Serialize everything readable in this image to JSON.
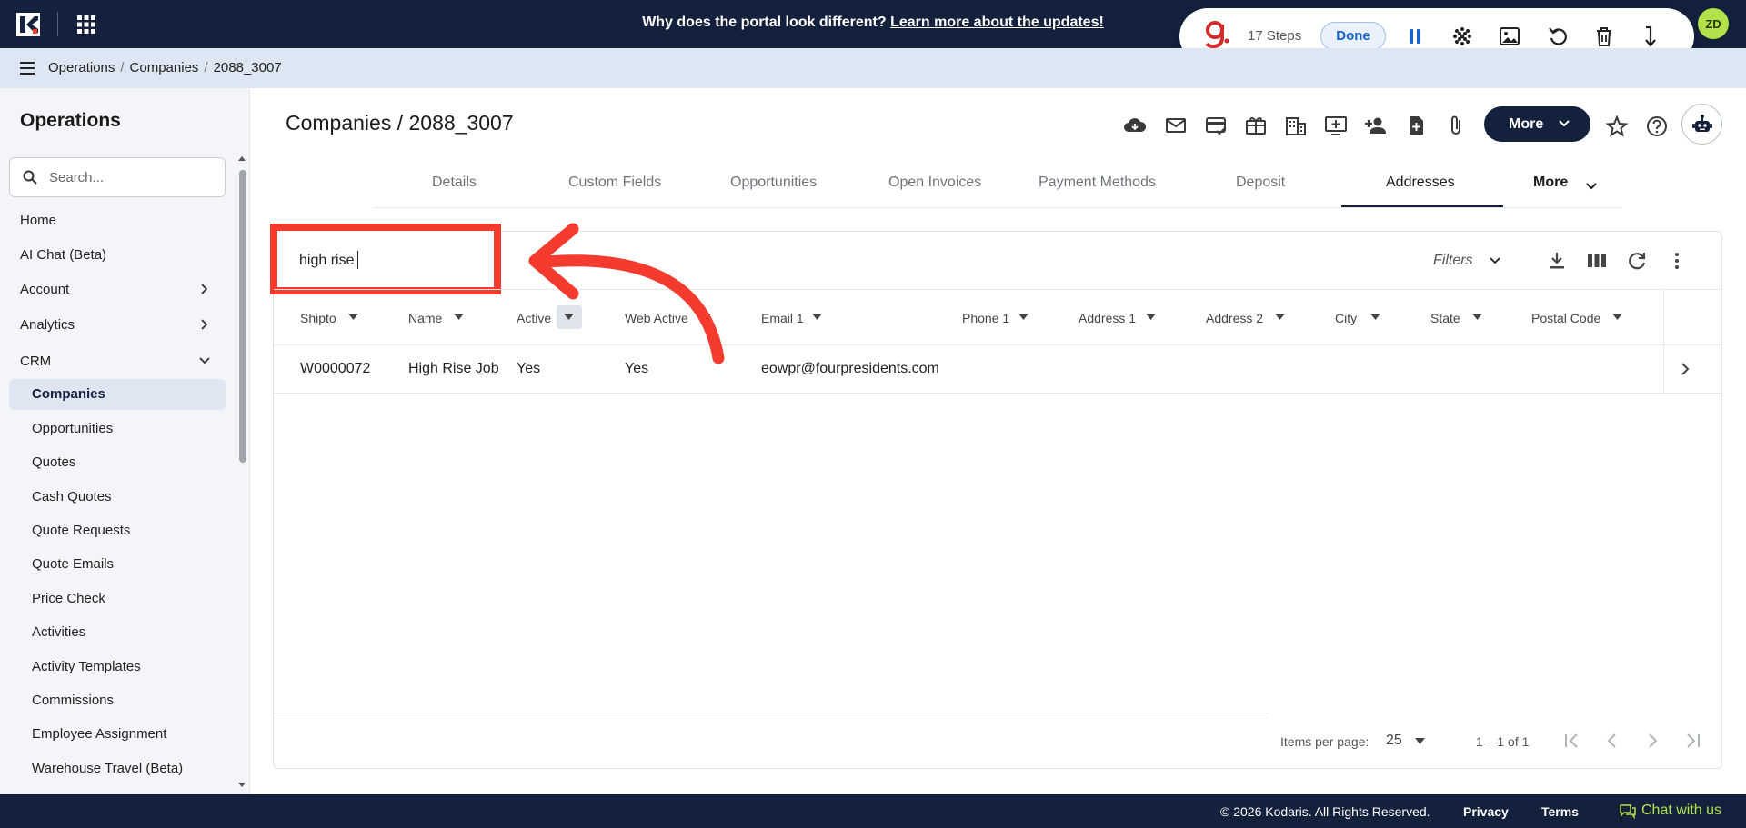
{
  "banner": {
    "text": "Why does the portal look different? ",
    "link": "Learn more about the updates!"
  },
  "recorder": {
    "steps": "17 Steps",
    "done": "Done"
  },
  "user": {
    "initials": "ZD"
  },
  "breadcrumb": {
    "items": [
      "Operations",
      "Companies",
      "2088_3007"
    ]
  },
  "sidebar": {
    "title": "Operations",
    "search_placeholder": "Search...",
    "items": [
      "Home",
      "AI Chat (Beta)",
      "Account",
      "Analytics",
      "CRM"
    ],
    "crm_items": [
      "Companies",
      "Opportunities",
      "Quotes",
      "Cash Quotes",
      "Quote Requests",
      "Quote Emails",
      "Price Check",
      "Activities",
      "Activity Templates",
      "Commissions",
      "Employee Assignment",
      "Warehouse Travel (Beta)"
    ]
  },
  "page": {
    "title": "Companies / 2088_3007",
    "more_label": "More"
  },
  "tabs": [
    "Details",
    "Custom Fields",
    "Opportunities",
    "Open Invoices",
    "Payment Methods",
    "Deposit",
    "Addresses",
    "More"
  ],
  "table": {
    "search_value": "high rise",
    "filters_label": "Filters",
    "columns": [
      "Shipto",
      "Name",
      "Active",
      "Web Active",
      "Email 1",
      "Phone 1",
      "Address 1",
      "Address 2",
      "City",
      "State",
      "Postal Code"
    ],
    "rows": [
      [
        "W0000072",
        "High Rise Job",
        "Yes",
        "Yes",
        "eowpr@fourpresidents.com",
        "",
        "",
        "",
        "",
        "",
        ""
      ]
    ],
    "pager": {
      "label": "Items per page:",
      "size": "25",
      "range": "1 – 1 of 1"
    }
  },
  "footer": {
    "copyright": "© 2026 Kodaris. All Rights Reserved.",
    "privacy": "Privacy",
    "terms": "Terms",
    "chat": "Chat with us"
  },
  "colors": {
    "navy": "#14213d",
    "accent_green": "#b4e04a",
    "annotation_red": "#f53a2e"
  }
}
